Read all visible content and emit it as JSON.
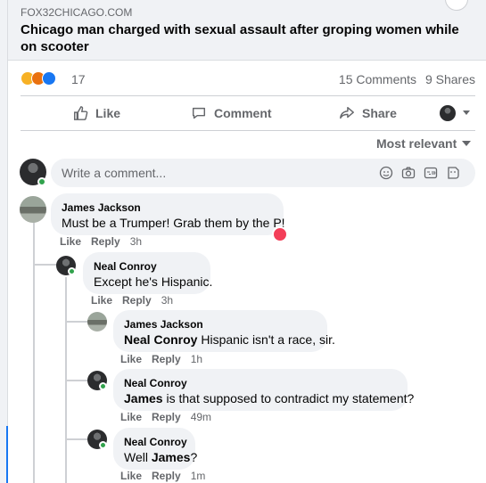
{
  "link_preview": {
    "domain": "FOX32CHICAGO.COM",
    "headline": "Chicago man charged with sexual assault after groping women while on scooter"
  },
  "reactions": {
    "count": "17"
  },
  "engagement": {
    "comments": "15 Comments",
    "shares": "9 Shares"
  },
  "actions": {
    "like": "Like",
    "comment": "Comment",
    "share": "Share"
  },
  "sort": {
    "label": "Most relevant"
  },
  "composer": {
    "placeholder": "Write a comment..."
  },
  "comments": [
    {
      "author": "James Jackson",
      "text": "Must be a Trumper! Grab them by the P!",
      "like": "Like",
      "reply": "Reply",
      "time": "3h"
    },
    {
      "author": "Neal Conroy",
      "text": "Except he's Hispanic.",
      "like": "Like",
      "reply": "Reply",
      "time": "3h"
    },
    {
      "author": "James Jackson",
      "mention": "Neal Conroy",
      "text": " Hispanic isn't a race, sir.",
      "like": "Like",
      "reply": "Reply",
      "time": "1h"
    },
    {
      "author": "Neal Conroy",
      "mention": "James",
      "text": " is that supposed to contradict my statement?",
      "like": "Like",
      "reply": "Reply",
      "time": "49m"
    },
    {
      "author": "Neal Conroy",
      "prefix": "Well ",
      "mention": "James",
      "text": "?",
      "like": "Like",
      "reply": "Reply",
      "time": "1m"
    }
  ],
  "colors": {
    "accent": "#1877f2",
    "online": "#31a24c",
    "heart": "#f33e58"
  }
}
